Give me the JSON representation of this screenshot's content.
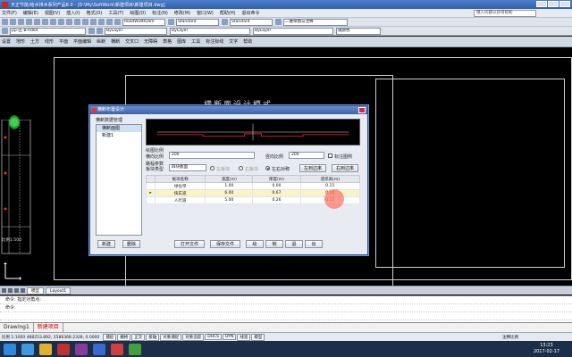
{
  "window": {
    "title": "天正节能/给水排水系列产品8.0 - [D:\\My\\SoftWork\\新建项目\\新建项目.dwg]"
  },
  "menubar": {
    "items": [
      "文件(F)",
      "编辑(E)",
      "视图(V)",
      "插入(I)",
      "格式(O)",
      "工具(T)",
      "绘图(D)",
      "标注(N)",
      "修改(M)",
      "窗口(W)",
      "帮助(H)",
      "退出命令"
    ],
    "help_box": "键入问题以获得帮助"
  },
  "toolbar1": {
    "style1": "RoadWidthDim",
    "style2": "Standard",
    "style3": "Standard",
    "workspace": "二维草图与注释"
  },
  "toolbar2": {
    "layer": "pp-区-B-hdkd",
    "color": "ByLayer",
    "linetype": "ByLayer",
    "lineweight": "ByLayer",
    "plot": "随颜色"
  },
  "cad_menu": {
    "items": [
      "设置",
      "地形",
      "土方",
      "线形",
      "平面",
      "平面编辑",
      "纵断",
      "横断",
      "交叉口",
      "无障碍",
      "表格",
      "图库",
      "工具",
      "标注标线",
      "文字",
      "帮助"
    ]
  },
  "drawing": {
    "scale_label": "比例1:500"
  },
  "dialog": {
    "title": "横断布置设计",
    "group_label": "横断数据管理",
    "list_header": "横断面图",
    "list_items": [
      "新建1"
    ],
    "section_ratio": "绘图比例",
    "h_ratio_label": "横向比例",
    "h_ratio_value": "200",
    "v_ratio_label": "竖向比例",
    "v_ratio_value": "200",
    "mark_label": "标注图例",
    "params_label": "路幅参数",
    "block_type_label": "板块类型",
    "block_type_value": "四块板面",
    "radio_left": "左板块",
    "radio_right": "右板块",
    "radio_both": "左右对称",
    "left_edge": "左到边率",
    "right_edge": "右到边率",
    "table_headers": [
      "板块名称",
      "宽度(m)",
      "厚度(m)",
      "道牙高(m)"
    ],
    "rows": [
      {
        "marker": "",
        "name": "绿化带",
        "width": "1.00",
        "depth": "0.00",
        "curb": "0.15"
      },
      {
        "marker": "▸",
        "name": "快车道",
        "width": "6.00",
        "depth": "0.67",
        "curb": "0.16"
      },
      {
        "marker": "",
        "name": "人行道",
        "width": "5.00",
        "depth": "0.26",
        "curb": "0.15"
      }
    ],
    "btn_new": "新建",
    "btn_delete": "删除",
    "btn_open": "打开文件",
    "btn_save": "保存文件",
    "btn_draw": "绘",
    "btn_make": "制",
    "btn_back": "退",
    "btn_exit": "出"
  },
  "overlay_text": "横断面设计模式",
  "tabs": {
    "model": "模型",
    "layout": "Layout1"
  },
  "command": {
    "line1": "命令: 指定对角点:",
    "line2": "命令:",
    "line3": ""
  },
  "files": {
    "drawing": "Drawing1",
    "project": "新建项目"
  },
  "status": {
    "coords": "比例 1:1000  488253.892, 2586368.2328, 0.0000",
    "modes": [
      "捕捉",
      "栅格",
      "正交",
      "极轴",
      "对象捕捉",
      "对象追踪",
      "DUCS",
      "DYN",
      "线宽",
      "模型"
    ],
    "annotation": "注释比例"
  },
  "taskbar": {
    "time": "13:23",
    "date": "2017-02-17"
  }
}
